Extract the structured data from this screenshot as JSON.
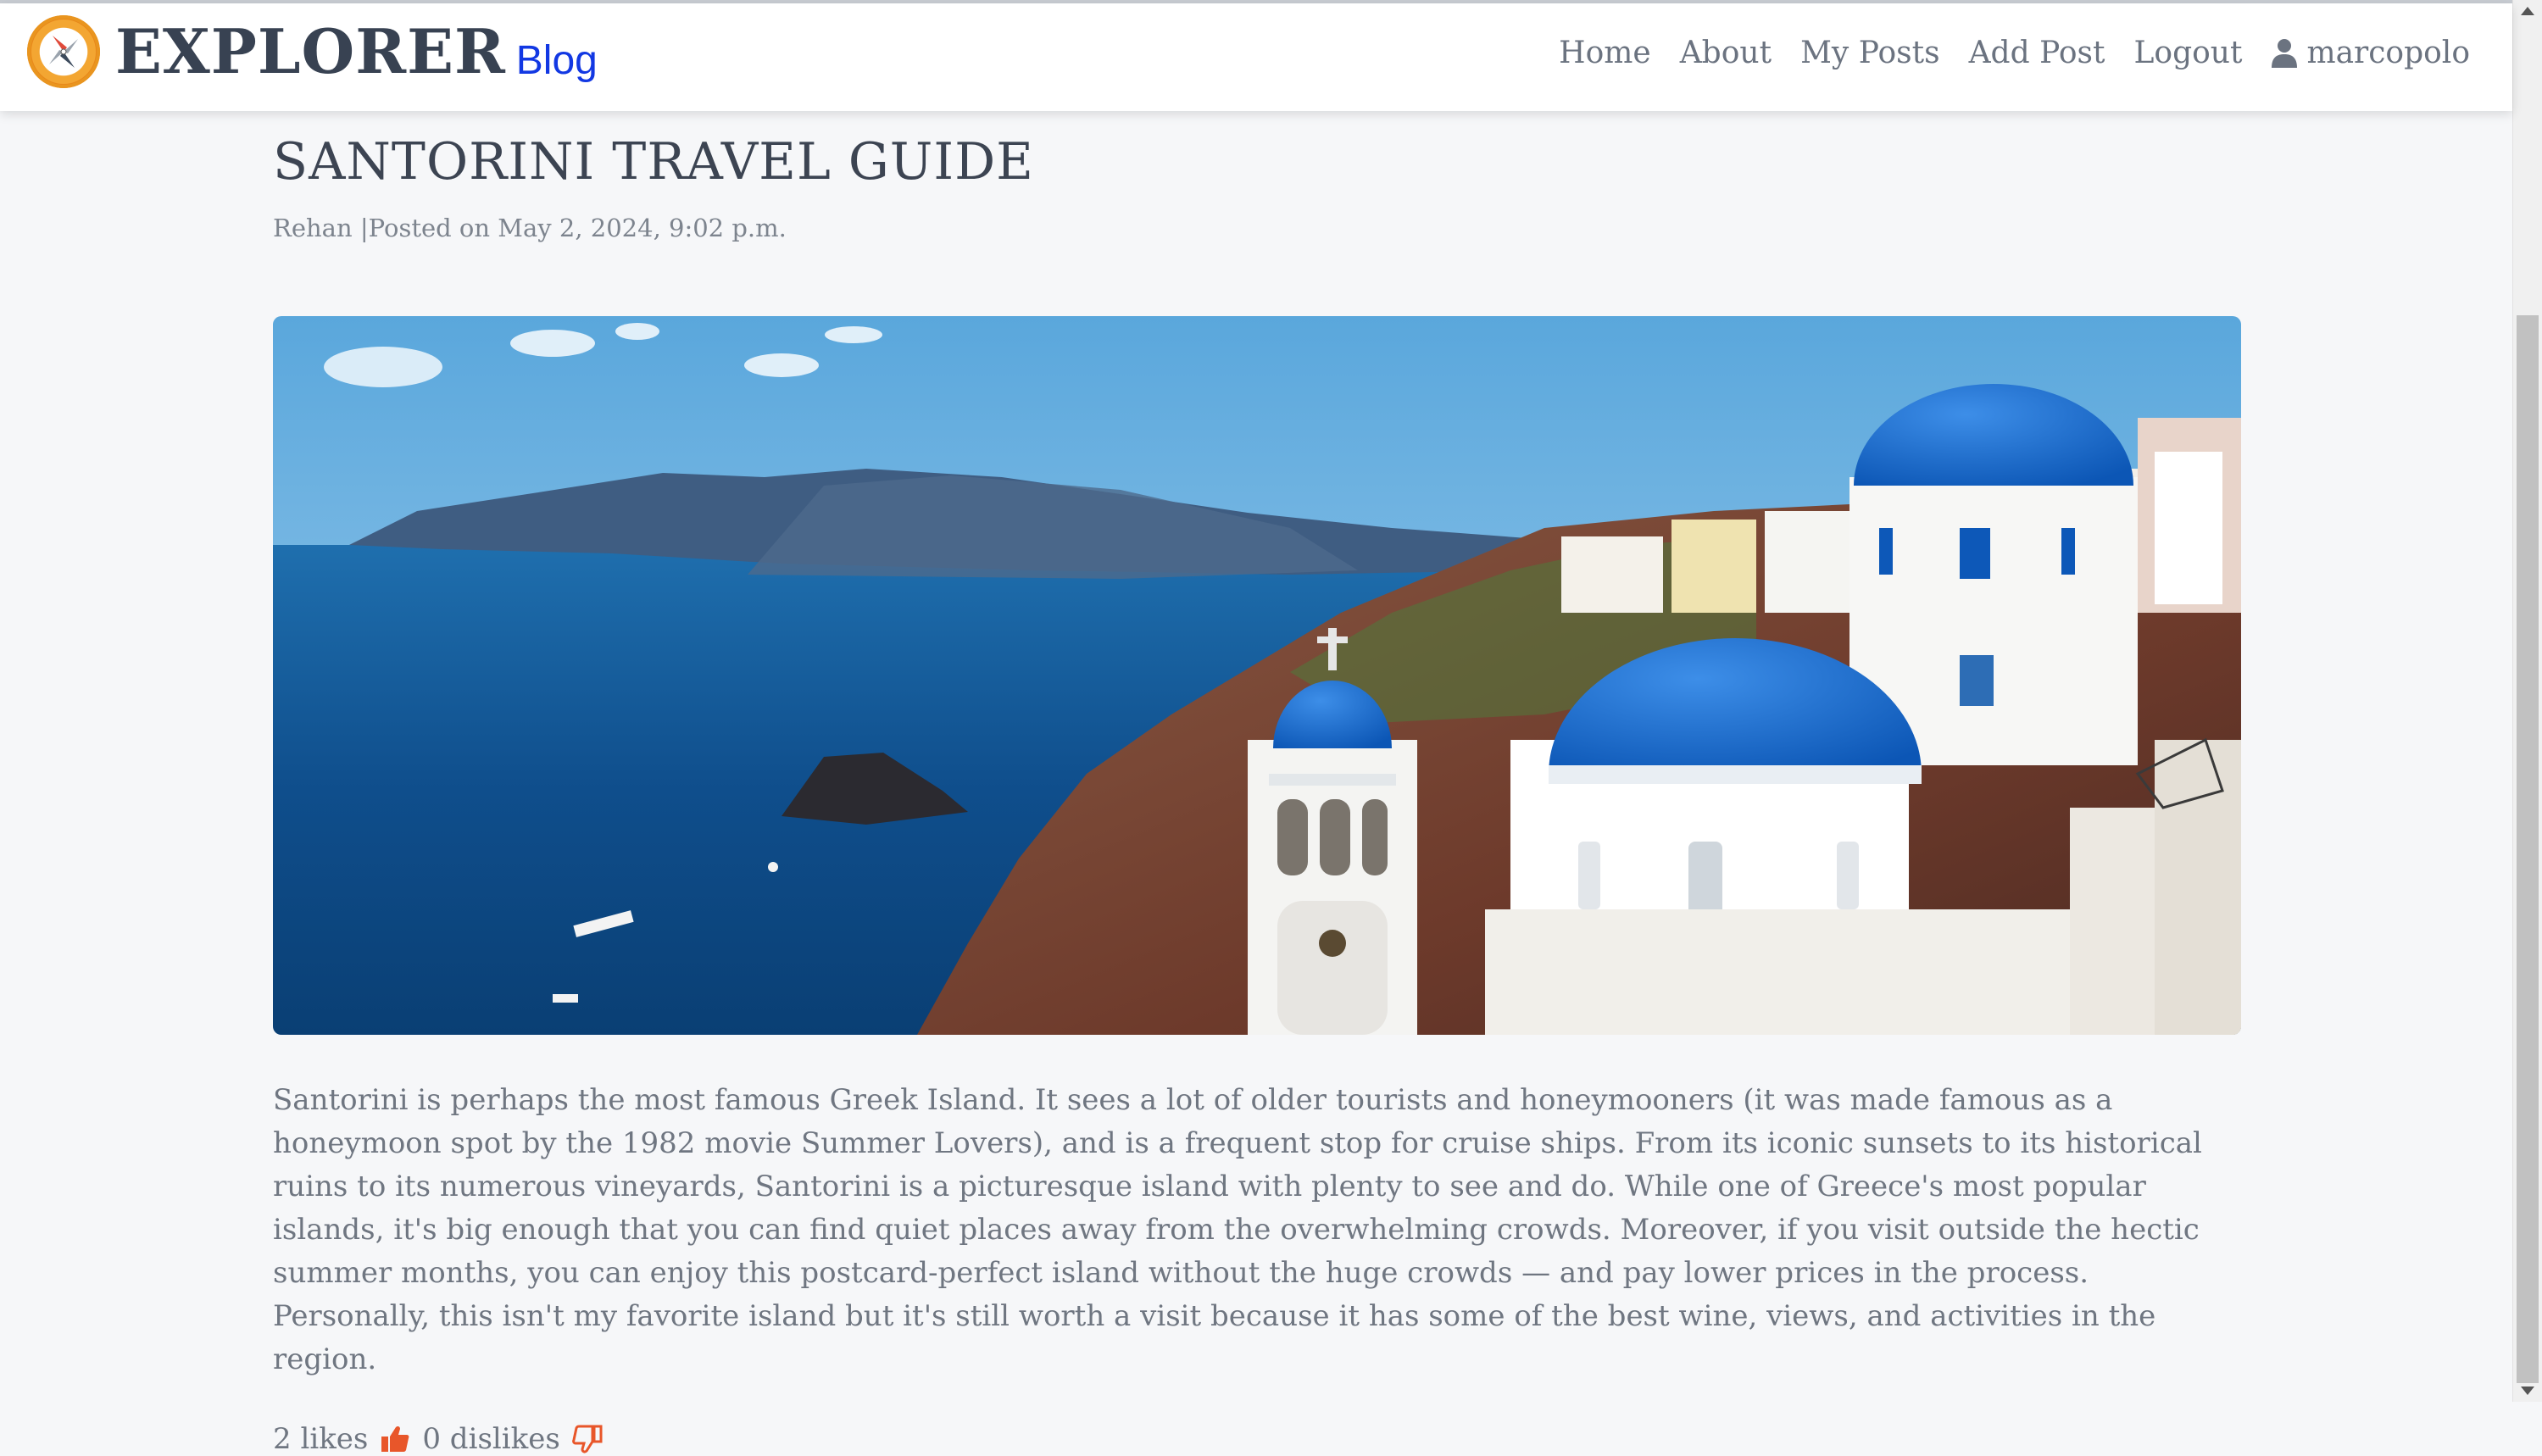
{
  "brand": {
    "title": "EXPLORER",
    "subtitle": "Blog",
    "logo_icon": "compass-icon"
  },
  "nav": {
    "items": [
      {
        "label": "Home"
      },
      {
        "label": "About"
      },
      {
        "label": "My Posts"
      },
      {
        "label": "Add Post"
      },
      {
        "label": "Logout"
      }
    ],
    "user": {
      "label": "marcopolo",
      "icon": "user-icon"
    }
  },
  "post": {
    "title": "SANTORINI TRAVEL GUIDE",
    "author": "Rehan",
    "meta_separator": " |",
    "posted_on": "Posted on May 2, 2024, 9:02 p.m.",
    "image_alt": "Santorini blue domed churches overlooking the caldera",
    "body": "Santorini is perhaps the most famous Greek Island. It sees a lot of older tourists and honeymooners (it was made famous as a honeymoon spot by the 1982 movie Summer Lovers), and is a frequent stop for cruise ships. From its iconic sunsets to its historical ruins to its numerous vineyards, Santorini is a picturesque island with plenty to see and do. While one of Greece's most popular islands, it's big enough that you can find quiet places away from the overwhelming crowds. Moreover, if you visit outside the hectic summer months, you can enjoy this postcard-perfect island without the huge crowds — and pay lower prices in the process. Personally, this isn't my favorite island but it's still worth a visit because it has some of the best wine, views, and activities in the region.",
    "likes": "2 likes",
    "dislikes": "0 dislikes"
  },
  "colors": {
    "brand_blue": "#1238e3",
    "accent_orange": "#e8562a",
    "text": "#6f7681"
  }
}
